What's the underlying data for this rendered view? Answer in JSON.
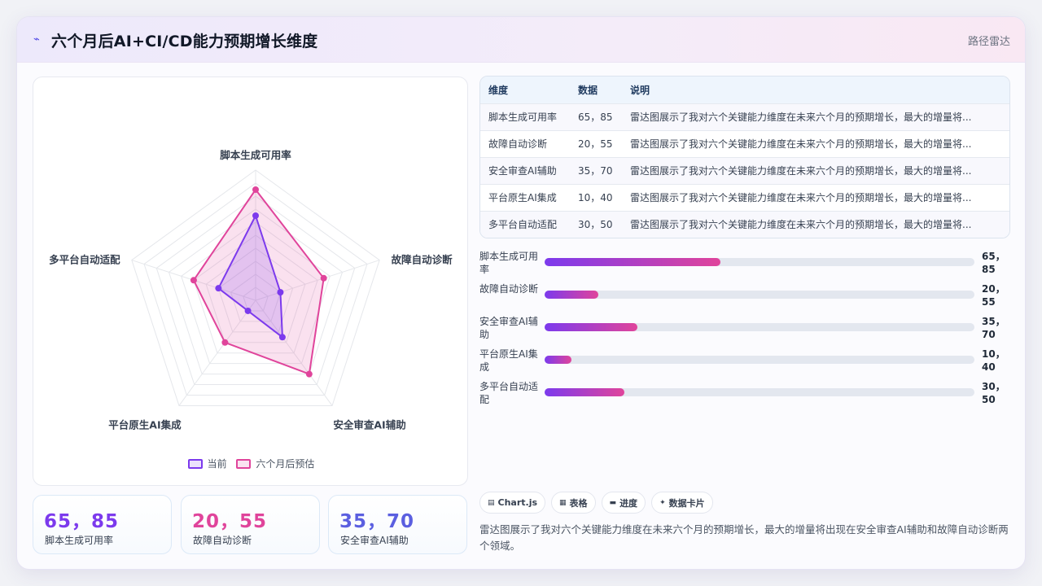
{
  "header": {
    "icon": "trend-line-icon",
    "title": "六个月后AI+CI/CD能力预期增长维度",
    "link": "路径雷达"
  },
  "colors": {
    "current": "#7c3aed",
    "future": "#e0449b",
    "stat_1": "#7c3aed",
    "stat_2": "#e0449b",
    "stat_3": "#5b5fe0"
  },
  "chart_data": {
    "type": "radar",
    "categories": [
      "脚本生成可用率",
      "故障自动诊断",
      "安全审查AI辅助",
      "平台原生AI集成",
      "多平台自动适配"
    ],
    "series": [
      {
        "name": "当前",
        "values": [
          65,
          20,
          35,
          10,
          30
        ]
      },
      {
        "name": "六个月后预估",
        "values": [
          85,
          55,
          70,
          40,
          50
        ]
      }
    ],
    "rlim": [
      0,
      100
    ],
    "grid": true,
    "legend": "bottom"
  },
  "table": {
    "headers": [
      "维度",
      "数据",
      "说明"
    ],
    "rows": [
      {
        "dim": "脚本生成可用率",
        "data": "65，85",
        "desc": "雷达图展示了我对六个关键能力维度在未来六个月的预期增长，最大的增量将..."
      },
      {
        "dim": "故障自动诊断",
        "data": "20，55",
        "desc": "雷达图展示了我对六个关键能力维度在未来六个月的预期增长，最大的增量将..."
      },
      {
        "dim": "安全审查AI辅助",
        "data": "35，70",
        "desc": "雷达图展示了我对六个关键能力维度在未来六个月的预期增长，最大的增量将..."
      },
      {
        "dim": "平台原生AI集成",
        "data": "10，40",
        "desc": "雷达图展示了我对六个关键能力维度在未来六个月的预期增长，最大的增量将..."
      },
      {
        "dim": "多平台自动适配",
        "data": "30，50",
        "desc": "雷达图展示了我对六个关键能力维度在未来六个月的预期增长，最大的增量将..."
      }
    ]
  },
  "bars": [
    {
      "label": "脚本生成可用率",
      "value": "65，85",
      "level": 0.41
    },
    {
      "label": "故障自动诊断",
      "value": "20，55",
      "level": 0.125
    },
    {
      "label": "安全审查AI辅助",
      "value": "35，70",
      "level": 0.215
    },
    {
      "label": "平台原生AI集成",
      "value": "10，40",
      "level": 0.062
    },
    {
      "label": "多平台自动适配",
      "value": "30，50",
      "level": 0.186
    }
  ],
  "stats": [
    {
      "value": "65，85",
      "label": "脚本生成可用率"
    },
    {
      "value": "20，55",
      "label": "故障自动诊断"
    },
    {
      "value": "35，70",
      "label": "安全审查AI辅助"
    }
  ],
  "chips": [
    {
      "icon": "chart-icon",
      "glyph": "▤",
      "label": "Chart.js"
    },
    {
      "icon": "table-icon",
      "glyph": "▦",
      "label": "表格"
    },
    {
      "icon": "progress-icon",
      "glyph": "▬",
      "label": "进度"
    },
    {
      "icon": "sparkle-icon",
      "glyph": "✦",
      "label": "数据卡片"
    }
  ],
  "summary": "雷达图展示了我对六个关键能力维度在未来六个月的预期增长，最大的增量将出现在安全审查AI辅助和故障自动诊断两个领域。"
}
